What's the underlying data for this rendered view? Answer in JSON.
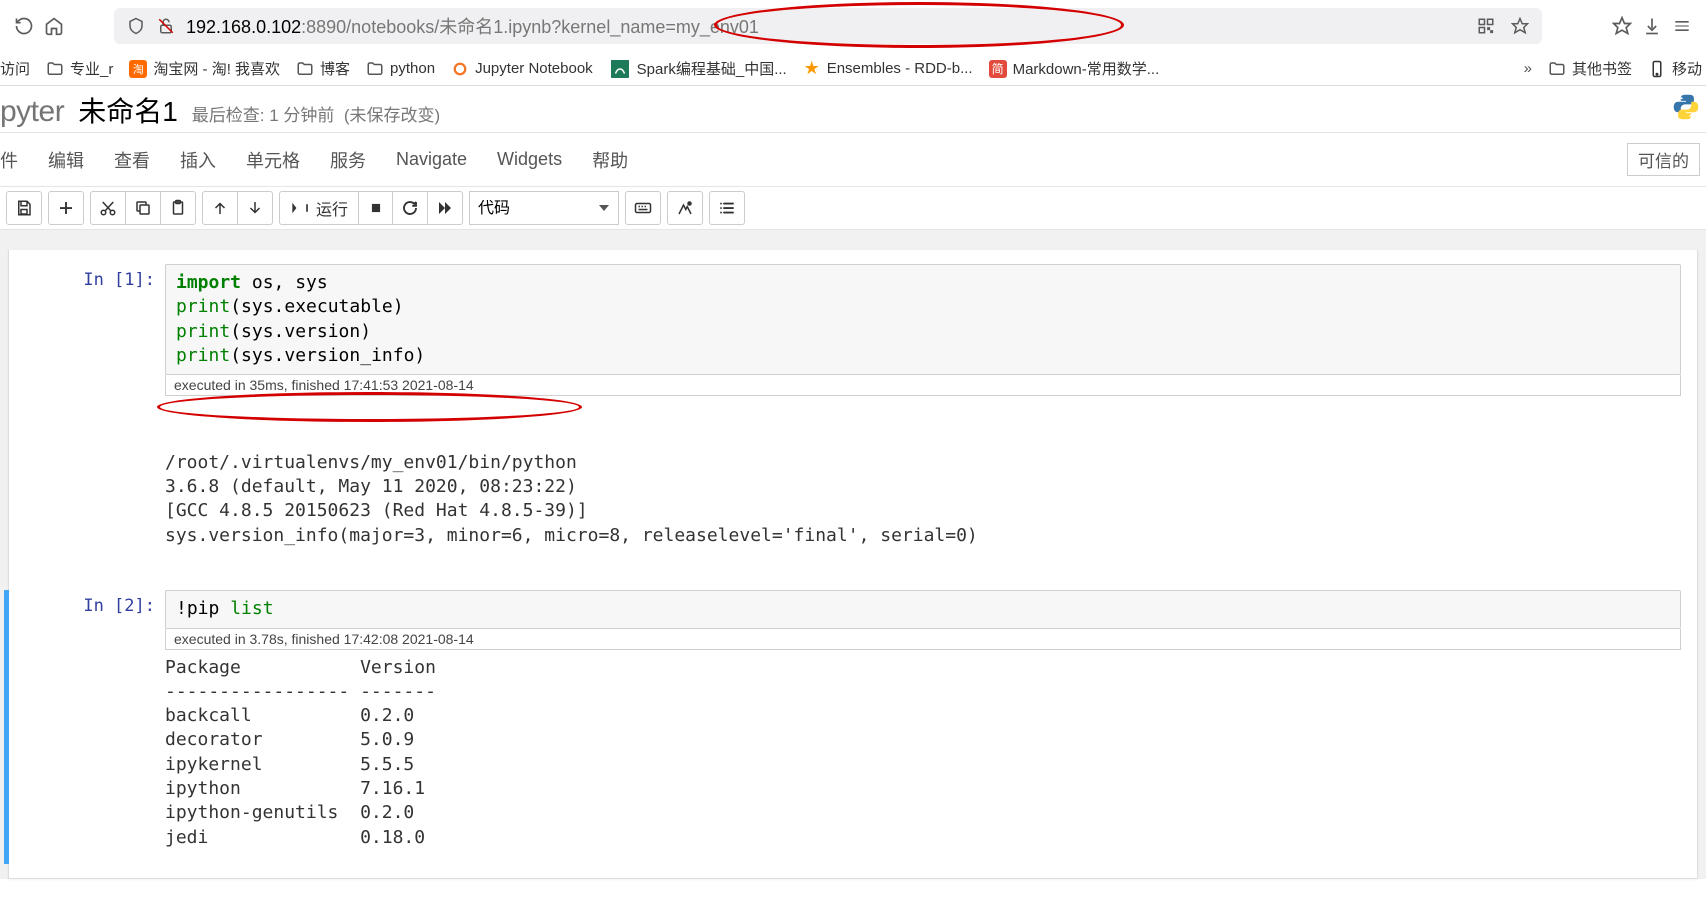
{
  "browser": {
    "url_host": "192.168.0.102",
    "url_rest": ":8890/notebooks/未命名1.ipynb?kernel_name=my_env01"
  },
  "bookmarks": {
    "visit_label": "访问",
    "items": [
      {
        "label": "专业_r",
        "type": "folder"
      },
      {
        "label": "淘宝网 - 淘! 我喜欢",
        "type": "taobao"
      },
      {
        "label": "博客",
        "type": "folder"
      },
      {
        "label": "python",
        "type": "folder"
      },
      {
        "label": "Jupyter Notebook",
        "type": "jupyter"
      },
      {
        "label": "Spark编程基础_中国...",
        "type": "spark"
      },
      {
        "label": "Ensembles - RDD-b...",
        "type": "ensembles"
      },
      {
        "label": "Markdown-常用数学...",
        "type": "markdown"
      }
    ],
    "other": "其他书签",
    "mobile": "移动"
  },
  "header": {
    "logo": "pyter",
    "title": "未命名1",
    "checkpoint": "最后检查: 1 分钟前",
    "unsaved": "(未保存改变)"
  },
  "menus": [
    "件",
    "编辑",
    "查看",
    "插入",
    "单元格",
    "服务",
    "Navigate",
    "Widgets",
    "帮助"
  ],
  "trusted": "可信的",
  "toolbar": {
    "run": "运行",
    "celltype": "代码"
  },
  "cells": [
    {
      "prompt": "In [1]:",
      "exec": "executed in 35ms, finished 17:41:53 2021-08-14",
      "output_lines": [
        "/root/.virtualenvs/my_env01/bin/python",
        "3.6.8 (default, May 11 2020, 08:23:22) ",
        "[GCC 4.8.5 20150623 (Red Hat 4.8.5-39)]",
        "sys.version_info(major=3, minor=6, micro=8, releaselevel='final', serial=0)"
      ]
    },
    {
      "prompt": "In [2]:",
      "exec": "executed in 3.78s, finished 17:42:08 2021-08-14",
      "output_header1": "Package           Version",
      "output_header2": "----------------- -------",
      "packages": [
        {
          "name": "backcall",
          "ver": "0.2.0"
        },
        {
          "name": "decorator",
          "ver": "5.0.9"
        },
        {
          "name": "ipykernel",
          "ver": "5.5.5"
        },
        {
          "name": "ipython",
          "ver": "7.16.1"
        },
        {
          "name": "ipython-genutils",
          "ver": "0.2.0"
        },
        {
          "name": "jedi",
          "ver": "0.18.0"
        }
      ]
    }
  ]
}
